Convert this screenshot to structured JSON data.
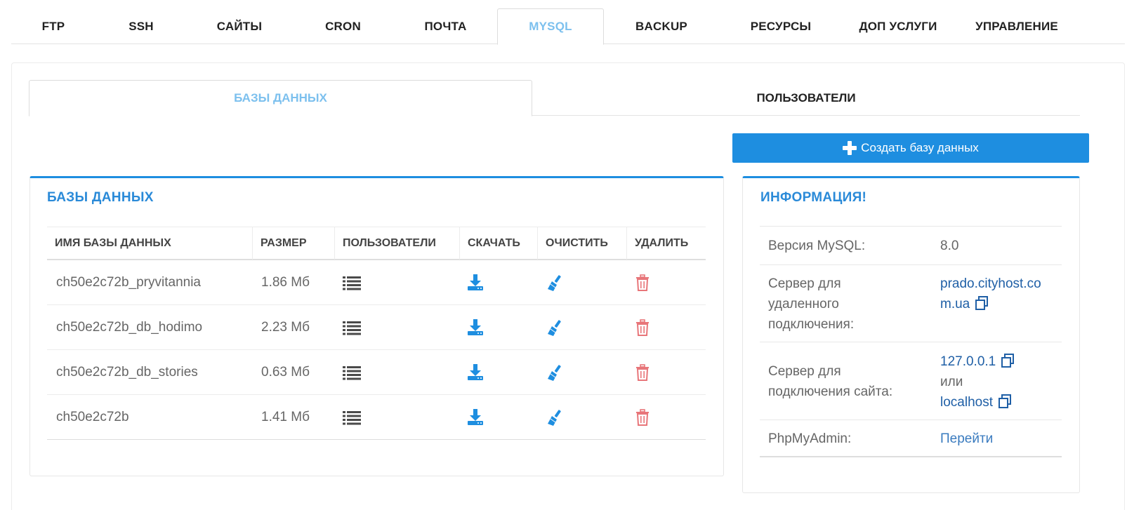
{
  "top_tabs": [
    {
      "label": "FTP",
      "active": false
    },
    {
      "label": "SSH",
      "active": false
    },
    {
      "label": "САЙТЫ",
      "active": false
    },
    {
      "label": "CRON",
      "active": false
    },
    {
      "label": "ПОЧТА",
      "active": false
    },
    {
      "label": "MYSQL",
      "active": true
    },
    {
      "label": "BACKUP",
      "active": false
    },
    {
      "label": "РЕСУРСЫ",
      "active": false
    },
    {
      "label": "ДОП УСЛУГИ",
      "active": false
    },
    {
      "label": "УПРАВЛЕНИЕ",
      "active": false
    }
  ],
  "sub_tabs": [
    {
      "label": "БАЗЫ ДАННЫХ",
      "active": true
    },
    {
      "label": "ПОЛЬЗОВАТЕЛИ",
      "active": false
    }
  ],
  "create_button": {
    "label": "Создать базу данных",
    "icon": "plus-icon"
  },
  "databases": {
    "title": "БАЗЫ ДАННЫХ",
    "headers": [
      "ИМЯ БАЗЫ ДАННЫХ",
      "РАЗМЕР",
      "ПОЛЬЗОВАТЕЛИ",
      "СКАЧАТЬ",
      "ОЧИСТИТЬ",
      "УДАЛИТЬ"
    ],
    "rows": [
      {
        "name": "ch50e2c72b_pryvitannia",
        "size": "1.86 Мб"
      },
      {
        "name": "ch50e2c72b_db_hodimo",
        "size": "2.23 Мб"
      },
      {
        "name": "ch50e2c72b_db_stories",
        "size": "0.63 Мб"
      },
      {
        "name": "ch50e2c72b",
        "size": "1.41 Мб"
      }
    ],
    "row_icons": {
      "users": "list-icon",
      "download": "download-icon",
      "clear": "broom-icon",
      "delete": "trash-icon"
    }
  },
  "info": {
    "title": "ИНФОРМАЦИЯ!",
    "mysql_version_label": "Версия MySQL:",
    "mysql_version": "8.0",
    "remote_server_label_1": "Сервер для",
    "remote_server_label_2": "удаленного",
    "remote_server_label_3": "подключения:",
    "remote_server_1": "prado.cityhost.co",
    "remote_server_2": "m.ua",
    "site_server_label_1": "Сервер для",
    "site_server_label_2": "подключения сайта:",
    "site_server_ip": "127.0.0.1",
    "site_server_or": "или",
    "site_server_host": "localhost",
    "phpmyadmin_label": "PhpMyAdmin:",
    "phpmyadmin_link": "Перейти"
  },
  "colors": {
    "accent": "#1e8ee0",
    "active_tab": "#7cc0ee",
    "title_blue": "#2a8ad8",
    "link": "#1f5fa6",
    "delete_red": "#e8767a"
  }
}
